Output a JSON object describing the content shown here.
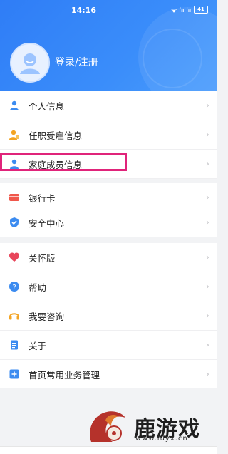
{
  "status_bar": {
    "time": "14:16",
    "signal": "ᯤ ˈᵢₗ ˈᵢₗ",
    "battery": "41"
  },
  "profile": {
    "login_label": "登录/注册"
  },
  "group1": [
    {
      "label": "个人信息",
      "icon": "person-icon",
      "color": "#3b8bf0"
    },
    {
      "label": "任职受雇信息",
      "icon": "employment-icon",
      "color": "#f3a423"
    },
    {
      "label": "家庭成员信息",
      "icon": "family-icon",
      "color": "#3b8bf0"
    },
    {
      "label": "银行卡",
      "icon": "bank-card-icon",
      "color": "#f0574b"
    }
  ],
  "group2": [
    {
      "label": "安全中心",
      "icon": "shield-icon",
      "color": "#3b8bf0"
    }
  ],
  "group3": [
    {
      "label": "关怀版",
      "icon": "heart-icon",
      "color": "#e8465b"
    },
    {
      "label": "帮助",
      "icon": "help-icon",
      "color": "#3b8bf0"
    },
    {
      "label": "我要咨询",
      "icon": "headset-icon",
      "color": "#f3a423"
    },
    {
      "label": "关于",
      "icon": "document-icon",
      "color": "#3b8bf0"
    },
    {
      "label": "首页常用业务管理",
      "icon": "grid-add-icon",
      "color": "#3b8bf0"
    }
  ],
  "watermark": {
    "text": "鹿游戏",
    "sub": "www.luyx.cn"
  }
}
